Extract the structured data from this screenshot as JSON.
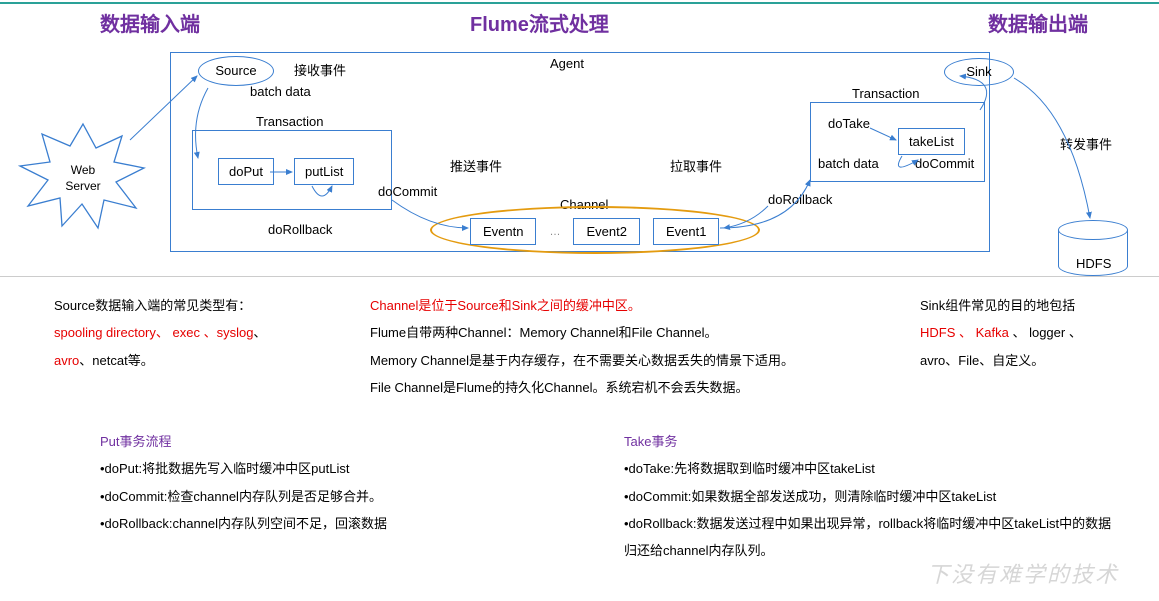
{
  "header": {
    "left": "数据输入端",
    "center": "Flume流式处理",
    "right": "数据输出端"
  },
  "agent": {
    "label": "Agent"
  },
  "source": {
    "label": "Source",
    "recv": "接收事件",
    "batch": "batch data"
  },
  "sink": {
    "label": "Sink",
    "fwd": "转发事件"
  },
  "transLeft": {
    "title": "Transaction",
    "doPut": "doPut",
    "putList": "putList",
    "doCommit": "doCommit",
    "doRollback": "doRollback"
  },
  "transRight": {
    "title": "Transaction",
    "doTake": "doTake",
    "takeList": "takeList",
    "doCommit": "doCommit",
    "doRollback": "doRollback",
    "batch": "batch data"
  },
  "push": "推送事件",
  "pull": "拉取事件",
  "channel": {
    "label": "Channel",
    "e1": "Eventn",
    "e2": "Event2",
    "e3": "Event1"
  },
  "web": {
    "line1": "Web",
    "line2": "Server"
  },
  "hdfs": "HDFS",
  "colLeft": {
    "l1": "Source数据输入端的常见类型有：",
    "l2p1": "spooling directory、 exec 、syslog",
    "l2p2": "、",
    "l3p1": "avro",
    "l3p2": "、netcat等。"
  },
  "colMid": {
    "l1": "Channel是位于Source和Sink之间的缓冲中区。",
    "l2": "Flume自带两种Channel：Memory Channel和File Channel。",
    "l3": "Memory Channel是基于内存缓存，在不需要关心数据丢失的情景下适用。",
    "l4": "File Channel是Flume的持久化Channel。系统宕机不会丢失数据。"
  },
  "colRight": {
    "l1": "Sink组件常见的目的地包括",
    "l2p1": "HDFS 、 Kafka",
    "l2p2": " 、 logger 、",
    "l3": "avro、File、自定义。"
  },
  "flowLeft": {
    "title": "Put事务流程",
    "b1": "•doPut:将批数据先写入临时缓冲中区putList",
    "b2": "•doCommit:检查channel内存队列是否足够合并。",
    "b3": "•doRollback:channel内存队列空间不足，回滚数据"
  },
  "flowRight": {
    "title": "Take事务",
    "b1": "•doTake:先将数据取到临时缓冲中区takeList",
    "b2": "•doCommit:如果数据全部发送成功，则清除临时缓冲中区takeList",
    "b3": "•doRollback:数据发送过程中如果出现异常，rollback将临时缓冲中区takeList中的数据归还给channel内存队列。"
  },
  "watermark": "下没有难学的技术"
}
